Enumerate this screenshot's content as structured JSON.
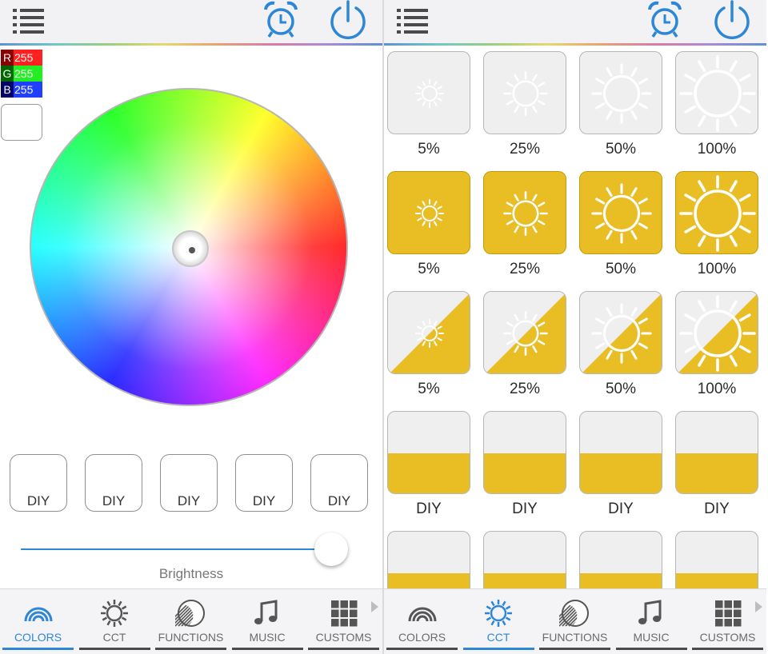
{
  "left_screen": {
    "rgb": {
      "r": {
        "label": "R",
        "value": "255",
        "color": "#ff2020"
      },
      "g": {
        "label": "G",
        "value": "255",
        "color": "#22ee22"
      },
      "b": {
        "label": "B",
        "value": "255",
        "color": "#2040ff"
      }
    },
    "diy_buttons": [
      "DIY",
      "DIY",
      "DIY",
      "DIY",
      "DIY"
    ],
    "brightness_label": "Brightness",
    "brightness_level": 0.97,
    "active_tab": "COLORS"
  },
  "right_screen": {
    "rows": [
      {
        "style": "plain",
        "labels": [
          "5%",
          "25%",
          "50%",
          "100%"
        ]
      },
      {
        "style": "gold",
        "labels": [
          "5%",
          "25%",
          "50%",
          "100%"
        ]
      },
      {
        "style": "half",
        "labels": [
          "5%",
          "25%",
          "50%",
          "100%"
        ]
      },
      {
        "style": "fill",
        "labels": [
          "DIY",
          "DIY",
          "DIY",
          "DIY"
        ]
      },
      {
        "style": "fill",
        "labels": [
          "",
          "",
          "",
          ""
        ]
      }
    ],
    "active_tab": "CCT"
  },
  "tabs": [
    {
      "label": "COLORS",
      "icon": "rainbow-icon"
    },
    {
      "label": "CCT",
      "icon": "sun-icon"
    },
    {
      "label": "FUNCTIONS",
      "icon": "hatched-circle-icon"
    },
    {
      "label": "MUSIC",
      "icon": "music-note-icon"
    },
    {
      "label": "CUSTOMS",
      "icon": "grid-icon"
    }
  ],
  "colors": {
    "accent": "#2d87d6",
    "gold": "#e9bd24",
    "tile_gray": "#efefef"
  }
}
